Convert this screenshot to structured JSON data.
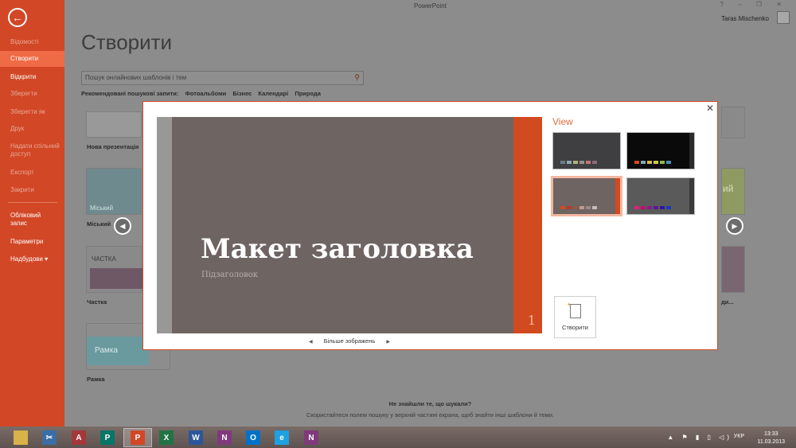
{
  "window": {
    "title": "PowerPoint",
    "controls": [
      "?",
      "–",
      "❐",
      "✕"
    ],
    "user": "Taras Mischenko"
  },
  "sidebar": {
    "items": [
      {
        "label": "Відомості",
        "state": "dim"
      },
      {
        "label": "Створити",
        "state": "active"
      },
      {
        "label": "Відкрити",
        "state": "normal"
      },
      {
        "label": "Зберегти",
        "state": "dim"
      },
      {
        "label": "Зберегти як",
        "state": "dim"
      },
      {
        "label": "Друк",
        "state": "dim"
      },
      {
        "label": "Надати спільний доступ",
        "state": "dim"
      },
      {
        "label": "Експорт",
        "state": "dim"
      },
      {
        "label": "Закрити",
        "state": "dim"
      },
      {
        "label": "Обліковий запис",
        "state": "normal"
      },
      {
        "label": "Параметри",
        "state": "normal"
      },
      {
        "label": "Надбудови ▾",
        "state": "normal"
      }
    ]
  },
  "main": {
    "page_title": "Створити",
    "search_placeholder": "Пошук онлайнових шаблонів і тем",
    "suggested": [
      "Рекомендовані пошукові запити:",
      "Фотоальбоми",
      "Бізнес",
      "Календарі",
      "Природа"
    ],
    "templates": {
      "blank": "Нова презентація",
      "city": "Міський",
      "city_thumb": "Міський",
      "part": "Частка",
      "part_thumb": "ЧАСТКА",
      "frame": "Рамка",
      "frame_thumb": "Рамка",
      "right_thumb_text": "ий",
      "right_label": "ди..."
    },
    "not_found_title": "Не знайшли те, що шукали?",
    "not_found_hint": "Скористайтеся полем пошуку у верхній частині екрана, щоб знайти інші шаблони й теми."
  },
  "dialog": {
    "slide_title": "Макет заголовка",
    "slide_subtitle": "Підзаголовок",
    "slide_number": "1",
    "more_images": "Більше зображень",
    "view_label": "View",
    "create_label": "Створити",
    "variants": [
      {
        "bg": "#3f3f41",
        "bar": "#3f3f41",
        "swatches": [
          "#6b7c8c",
          "#8fa7b5",
          "#b4b07a",
          "#9a8f8a",
          "#c2767a",
          "#8c6b7a"
        ]
      },
      {
        "bg": "#0a0a0a",
        "bar": "#2b2b2b",
        "swatches": [
          "#d24a1f",
          "#7ea6b8",
          "#e0b64a",
          "#c8c84a",
          "#8fb84a",
          "#4a8fb8"
        ]
      },
      {
        "bg": "#6e6462",
        "bar": "#d24a1f",
        "swatches": [
          "#d24a1f",
          "#b83a2a",
          "#8c5a4a",
          "#c09a8a",
          "#9a8a86",
          "#c8bcb8"
        ]
      },
      {
        "bg": "#5a5a5a",
        "bar": "#3a3a3a",
        "swatches": [
          "#e0207a",
          "#c0106a",
          "#8a1a8a",
          "#5a1a9a",
          "#2a1aa0",
          "#1a3ab8"
        ]
      }
    ]
  },
  "taskbar": {
    "apps": [
      {
        "name": "explorer-icon",
        "letter": "",
        "color": "#d9b24a"
      },
      {
        "name": "snipping-tool-icon",
        "letter": "✂",
        "color": "#3b6ea5"
      },
      {
        "name": "access-icon",
        "letter": "A",
        "color": "#a4373a"
      },
      {
        "name": "publisher-icon",
        "letter": "P",
        "color": "#077568"
      },
      {
        "name": "powerpoint-icon",
        "letter": "P",
        "color": "#d24726"
      },
      {
        "name": "excel-icon",
        "letter": "X",
        "color": "#217346"
      },
      {
        "name": "word-icon",
        "letter": "W",
        "color": "#2b579a"
      },
      {
        "name": "onenote-icon",
        "letter": "N",
        "color": "#80397b"
      },
      {
        "name": "outlook-icon",
        "letter": "O",
        "color": "#0072c6"
      },
      {
        "name": "internet-explorer-icon",
        "letter": "e",
        "color": "#1ea1e0"
      },
      {
        "name": "onenote-clipper-icon",
        "letter": "N",
        "color": "#80397b"
      }
    ],
    "language": "УКР",
    "time": "13:33",
    "date": "11.03.2013"
  }
}
